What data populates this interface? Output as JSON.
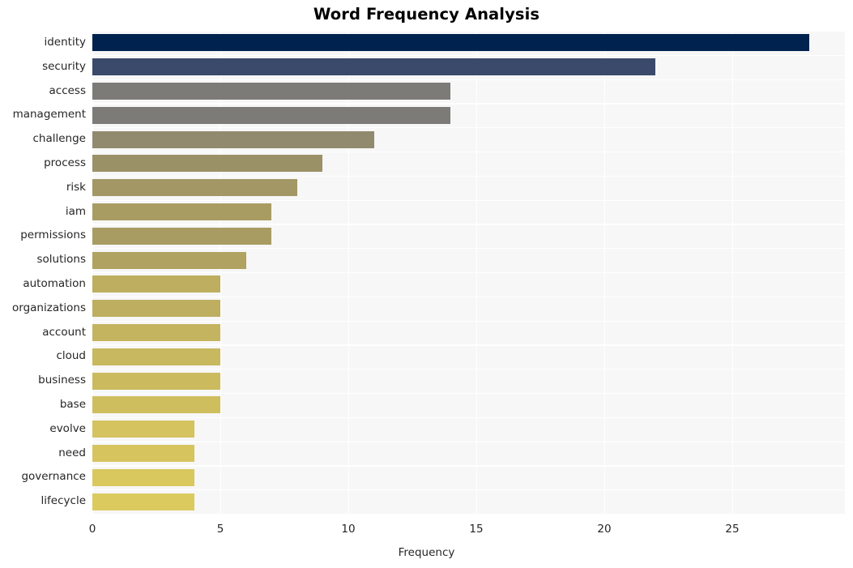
{
  "chart_data": {
    "type": "bar",
    "orientation": "horizontal",
    "title": "Word Frequency Analysis",
    "xlabel": "Frequency",
    "ylabel": "",
    "categories": [
      "identity",
      "security",
      "access",
      "management",
      "challenge",
      "process",
      "risk",
      "iam",
      "permissions",
      "solutions",
      "automation",
      "organizations",
      "account",
      "cloud",
      "business",
      "base",
      "evolve",
      "need",
      "governance",
      "lifecycle"
    ],
    "values": [
      28,
      22,
      14,
      14,
      11,
      9,
      8,
      7,
      7,
      6,
      5,
      5,
      5,
      5,
      5,
      5,
      4,
      4,
      4,
      4
    ],
    "bar_colors": [
      "#00224e",
      "#3b4a6b",
      "#7c7b78",
      "#7c7b78",
      "#918a6f",
      "#9b9167",
      "#a29765",
      "#a89c63",
      "#a89c63",
      "#b0a361",
      "#bdae60",
      "#bdae60",
      "#c4b45f",
      "#c8b85f",
      "#ccbb5e",
      "#cfbe5e",
      "#d4c35e",
      "#d6c55e",
      "#d9c85e",
      "#dbcb5f"
    ],
    "xticks": [
      0,
      5,
      10,
      15,
      20,
      25
    ],
    "xtick_labels": [
      "0",
      "5",
      "10",
      "15",
      "20",
      "25"
    ],
    "xlim": [
      0,
      29.4
    ],
    "grid": true,
    "legend": "none",
    "plot_background": "#f7f7f7",
    "grid_color": "#ffffff",
    "figure_background": "#ffffff",
    "text_color": "#262626"
  }
}
